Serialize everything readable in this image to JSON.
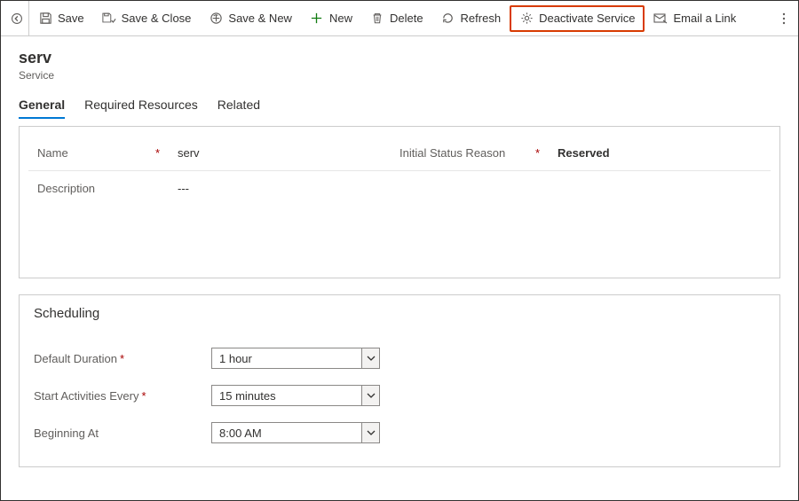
{
  "toolbar": {
    "save": "Save",
    "saveClose": "Save & Close",
    "saveNew": "Save & New",
    "new": "New",
    "delete": "Delete",
    "refresh": "Refresh",
    "deactivate": "Deactivate Service",
    "emailLink": "Email a Link"
  },
  "record": {
    "title": "serv",
    "subtitle": "Service"
  },
  "tabs": {
    "general": "General",
    "requiredResources": "Required Resources",
    "related": "Related"
  },
  "fields": {
    "nameLabel": "Name",
    "nameValue": "serv",
    "statusLabel": "Initial Status Reason",
    "statusValue": "Reserved",
    "descriptionLabel": "Description",
    "descriptionValue": "---"
  },
  "scheduling": {
    "title": "Scheduling",
    "defaultDurationLabel": "Default Duration",
    "defaultDurationValue": "1 hour",
    "startEveryLabel": "Start Activities Every",
    "startEveryValue": "15 minutes",
    "beginningAtLabel": "Beginning At",
    "beginningAtValue": "8:00 AM"
  }
}
